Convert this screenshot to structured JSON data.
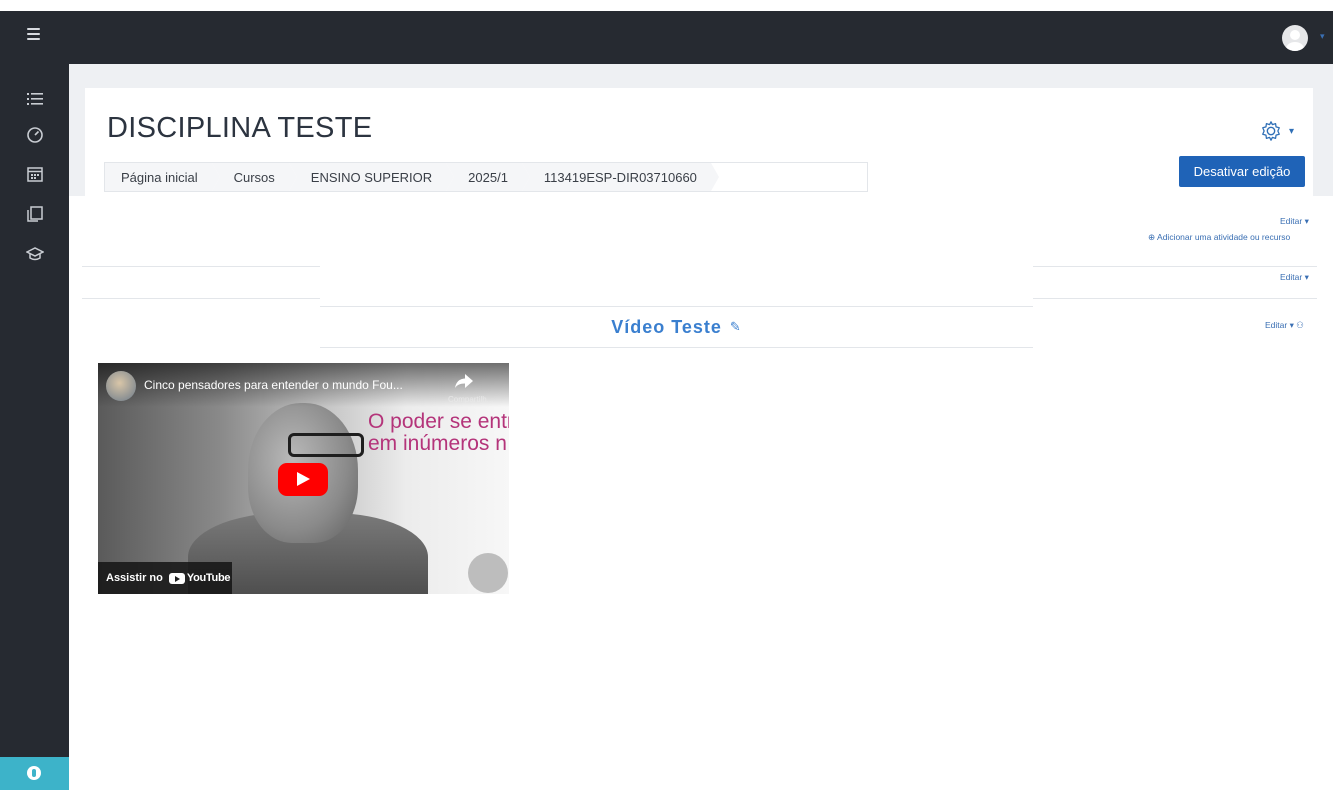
{
  "course": {
    "title": "DISCIPLINA TESTE",
    "breadcrumb": [
      "Página inicial",
      "Cursos",
      "ENSINO SUPERIOR",
      "2025/1",
      "113419ESP-DIR03710660"
    ],
    "toggle_edit_label": "Desativar edição"
  },
  "sections": {
    "edit_label": "Editar",
    "add_activity_label": "Adicionar uma atividade ou recurso",
    "topic_title": "Vídeo Teste"
  },
  "video": {
    "title": "Cinco pensadores para entender o mundo Fou...",
    "share_label": "Compartilh...",
    "overlay_line1": "O poder se entrelaça",
    "overlay_line2": "em inúmeros n",
    "watch_label": "Assistir no",
    "platform": "YouTube"
  },
  "colors": {
    "navbar": "#262a31",
    "primary": "#1f63b7",
    "link": "#3a6fb3",
    "accessibility": "#3db3c9"
  },
  "icons": {
    "navbar": [
      "hamburger-icon",
      "user-avatar-icon"
    ],
    "sidebar": [
      "list-icon",
      "dashboard-icon",
      "calendar-icon",
      "files-icon",
      "graduation-cap-icon",
      "accessibility-icon"
    ],
    "content": [
      "gear-icon",
      "pencil-icon",
      "plus-circle-icon",
      "user-icon",
      "play-icon",
      "share-icon"
    ]
  }
}
